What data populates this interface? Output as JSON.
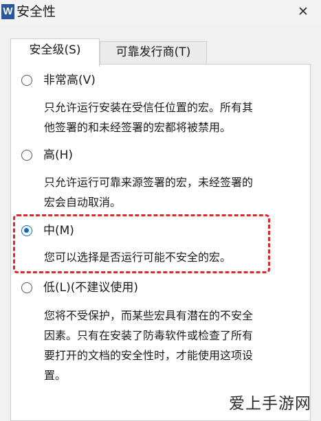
{
  "window": {
    "app_logo": "W",
    "title": "安全性",
    "close_glyph": "✕"
  },
  "tabs": [
    {
      "label": "安全级(S)",
      "selected": true
    },
    {
      "label": "可靠发行商(T)",
      "selected": false
    }
  ],
  "options": [
    {
      "label": "非常高(V)",
      "checked": false,
      "description": [
        "只允许运行安装在受信任位置的宏。所有其",
        "他签署的和未经签署的宏都将被禁用。"
      ]
    },
    {
      "label": "高(H)",
      "checked": false,
      "description": [
        "只允许运行可靠来源签署的宏，未经签署的",
        "宏会自动取消。"
      ]
    },
    {
      "label": "中(M)",
      "checked": true,
      "description": [
        "您可以选择是否运行可能不安全的宏。"
      ]
    },
    {
      "label": "低(L)(不建议使用)",
      "checked": false,
      "description": [
        "您将不受保护，而某些宏具有潜在的不安全",
        "因素。只有在安装了防毒软件或检查了所有",
        "要打开的文档的安全性时，才能使用这项设",
        "置。"
      ]
    }
  ],
  "highlight_color": "#e0262b",
  "accent_color": "#0f6cbd",
  "watermark": "爱上手游网"
}
